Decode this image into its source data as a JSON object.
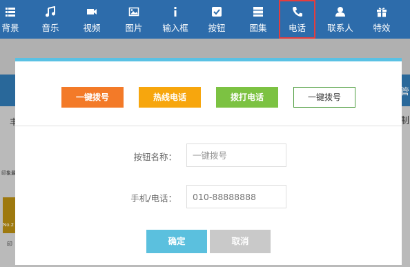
{
  "toolbar": {
    "items": [
      {
        "label": "背景",
        "icon": "list-icon"
      },
      {
        "label": "音乐",
        "icon": "music-note-icon"
      },
      {
        "label": "视频",
        "icon": "video-camera-icon"
      },
      {
        "label": "图片",
        "icon": "image-icon"
      },
      {
        "label": "输入框",
        "icon": "info-icon"
      },
      {
        "label": "按钮",
        "icon": "checkbox-icon"
      },
      {
        "label": "图集",
        "icon": "server-stack-icon"
      },
      {
        "label": "电话",
        "icon": "phone-icon"
      },
      {
        "label": "联系人",
        "icon": "person-icon"
      },
      {
        "label": "特效",
        "icon": "gift-icon"
      }
    ]
  },
  "background": {
    "fragments": {
      "right_1": "管",
      "right_2": "制",
      "left_1": "丰",
      "left_2": "印象最",
      "left_3": "No.2",
      "left_4": "印"
    }
  },
  "modal": {
    "presets": {
      "one_key": "一键拨号",
      "hotline": "热线电话",
      "dial": "拨打电话",
      "one_key_outline": "一键拨号"
    },
    "fields": {
      "name_label": "按钮名称：",
      "name_placeholder": "一键拨号",
      "phone_label": "手机/电话：",
      "phone_value": "010-88888888"
    },
    "buttons": {
      "confirm": "确定",
      "cancel": "取消"
    }
  },
  "colors": {
    "toolbar": "#2d6cab",
    "preset_orange": "#f37a28",
    "preset_yellow": "#f7a60d",
    "preset_green": "#7cc242",
    "confirm": "#5bc0de",
    "cancel": "#c9c9c9",
    "active_outline": "#e53d3d"
  }
}
